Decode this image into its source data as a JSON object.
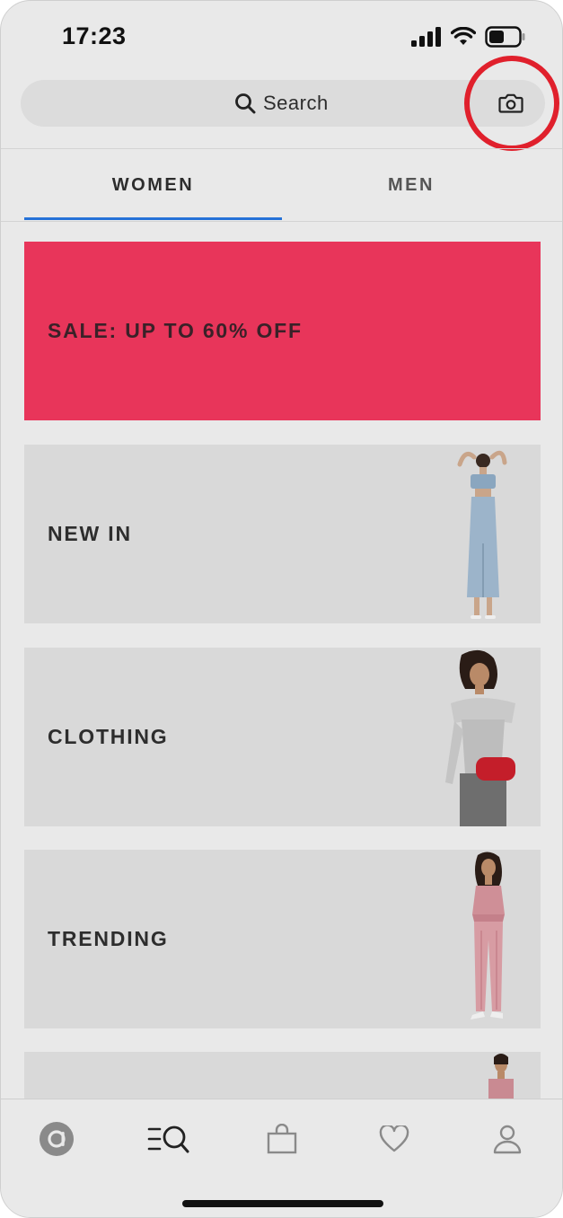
{
  "status_bar": {
    "time": "17:23"
  },
  "search": {
    "placeholder": "Search"
  },
  "tabs": [
    {
      "label": "WOMEN",
      "active": true
    },
    {
      "label": "MEN",
      "active": false
    }
  ],
  "categories": [
    {
      "label": "SALE: UP TO 60% OFF",
      "background": "#e8355a"
    },
    {
      "label": "NEW IN",
      "background": "#d9d9d9"
    },
    {
      "label": "CLOTHING",
      "background": "#d9d9d9"
    },
    {
      "label": "TRENDING",
      "background": "#d9d9d9"
    },
    {
      "label": "",
      "background": "#d9d9d9"
    }
  ],
  "bottom_nav": [
    {
      "icon": "home-logo-icon",
      "active": true
    },
    {
      "icon": "search-categories-icon",
      "active": false
    },
    {
      "icon": "bag-icon",
      "active": false
    },
    {
      "icon": "heart-icon",
      "active": false
    },
    {
      "icon": "account-icon",
      "active": false
    }
  ],
  "colors": {
    "accent_blue": "#2672d8",
    "sale_red": "#e8355a",
    "highlight_ring": "#e0202c"
  }
}
